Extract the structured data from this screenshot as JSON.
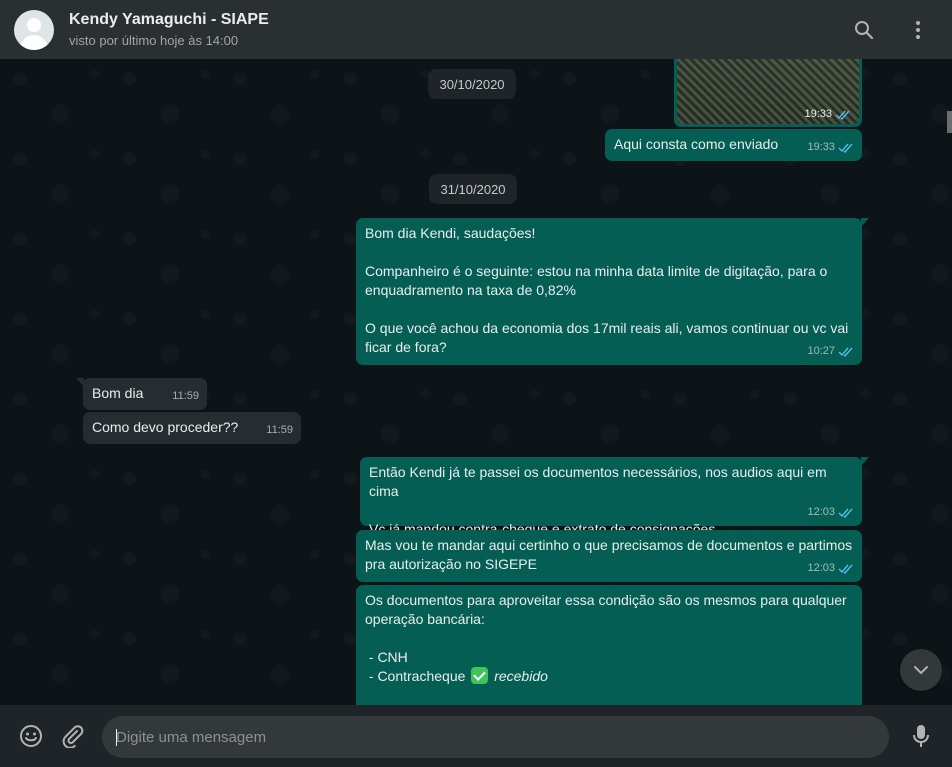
{
  "header": {
    "contact_name": "Kendy Yamaguchi - SIAPE",
    "status": "visto por último hoje às 14:00",
    "icons": [
      "search-icon",
      "menu-icon"
    ]
  },
  "messages": {
    "img": {
      "time": "19:33"
    },
    "m1": {
      "text": "Aqui consta como enviado",
      "time": "19:33"
    },
    "date1": "30/10/2020",
    "date2": "31/10/2020",
    "m2": {
      "p1": "Bom dia Kendi, saudações!",
      "p2": "Companheiro é o seguinte: estou na minha data limite de digitação, para o enquadramento na taxa de 0,82%",
      "p3": "O que você achou da economia dos 17mil reais ali, vamos continuar ou vc vai ficar de fora?",
      "time": "10:27"
    },
    "m3": {
      "text": "Bom dia",
      "time": "11:59"
    },
    "m4": {
      "text": "Como devo proceder??",
      "time": "11:59"
    },
    "m5": {
      "p1": "Então Kendi já te passei os documentos necessários, nos audios aqui em cima",
      "p2": "Vc já mandou contra-cheque e extrato de consignações",
      "time": "12:03"
    },
    "m6": {
      "text": "Mas vou te mandar aqui certinho o que precisamos de documentos e partimos pra autorização no SIGEPE",
      "time": "12:03"
    },
    "m7": {
      "p1": "Os documentos para aproveitar essa condição são os mesmos para qualquer operação bancária:",
      "item1": " - CNH",
      "item2": " - Contracheque",
      "item2_note": "recebido"
    }
  },
  "footer": {
    "placeholder": "Digite uma mensagem",
    "icons": [
      "emoji-icon",
      "attach-icon",
      "microphone-icon"
    ]
  },
  "colors": {
    "header_bg": "#2a2f32",
    "chat_bg": "#0d1418",
    "outgoing_bubble": "#055e54",
    "incoming_bubble": "#262d31",
    "read_ticks": "#53bdeb"
  }
}
